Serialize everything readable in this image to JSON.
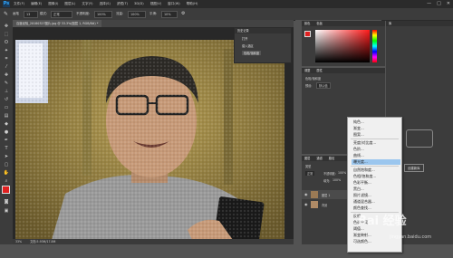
{
  "menubar": {
    "logo": "Ps",
    "menus": [
      "文件(F)",
      "编辑(E)",
      "图像(I)",
      "图层(L)",
      "文字(Y)",
      "选择(S)",
      "滤镜(T)",
      "3D(D)",
      "视图(V)",
      "窗口(W)",
      "帮助(H)"
    ],
    "controls": [
      "—",
      "□",
      "✕"
    ]
  },
  "options": {
    "tool_preset": "画笔",
    "size": "13",
    "mode_label": "模式:",
    "mode_value": "正常",
    "opacity_label": "不透明度:",
    "opacity_value": "100%",
    "flow_label": "流量:",
    "flow_value": "100%",
    "smooth_label": "平滑:",
    "smooth_value": "10%"
  },
  "document": {
    "tab_title": "百度经验_20180327图片.jpg @ 33.3%(图层 1, RGB/8#) *",
    "zoom": "33%",
    "doc_info": "文档:5.93M/17.8M"
  },
  "history": {
    "title": "历史记录",
    "items": [
      "打开",
      "载入选区",
      "色相/饱和度"
    ]
  },
  "panels": {
    "color_tab": "颜色",
    "swatches_tab": "色板",
    "adjust_tab": "调整",
    "props_tab": "属性",
    "props_subtitle": "色相/饱和度",
    "preset_label": "预设:",
    "preset_value": "默认值",
    "layers_tab": "图层",
    "channels_tab": "通道",
    "paths_tab": "路径",
    "kind_label": "类型",
    "blend_value": "正常",
    "opacity_label": "不透明度:",
    "opacity_value": "100%",
    "fill_label": "填充:",
    "fill_value": "100%",
    "layer1": "图层 1",
    "layer2": "背景",
    "lib_tab": "库",
    "lib_button": "创建新库"
  },
  "context_menu": {
    "items": [
      "纯色...",
      "渐变...",
      "图案...",
      "亮度/对比度...",
      "色阶...",
      "曲线...",
      "曝光度...",
      "自然饱和度...",
      "色相/饱和度...",
      "色彩平衡...",
      "黑白...",
      "照片滤镜...",
      "通道混合器...",
      "颜色查找...",
      "反相",
      "色调分离...",
      "阈值...",
      "渐变映射...",
      "可选颜色..."
    ],
    "highlighted_index": 6
  },
  "watermark": {
    "main": "Bai 经验",
    "sub": "jingyan.baidu.com"
  },
  "colors": {
    "accent_red": "#e02020",
    "menu_highlight": "#9bc6ee"
  }
}
